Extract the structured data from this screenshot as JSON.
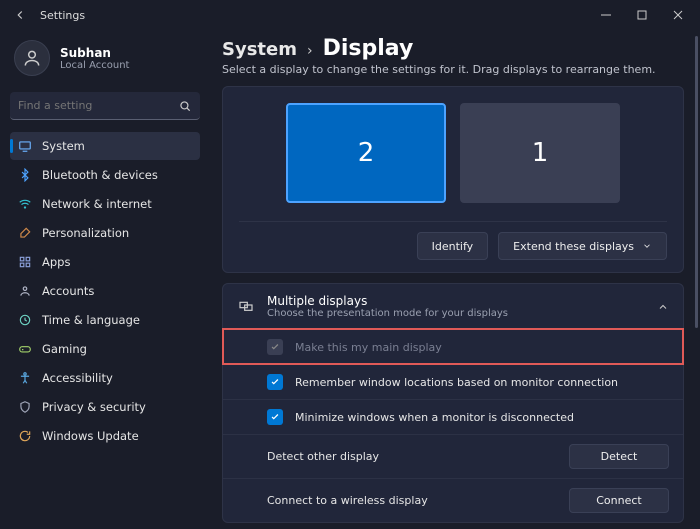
{
  "window": {
    "title": "Settings"
  },
  "profile": {
    "name": "Subhan",
    "sub": "Local Account"
  },
  "search": {
    "placeholder": "Find a setting"
  },
  "nav": [
    {
      "key": "system",
      "label": "System"
    },
    {
      "key": "bluetooth",
      "label": "Bluetooth & devices"
    },
    {
      "key": "network",
      "label": "Network & internet"
    },
    {
      "key": "personalization",
      "label": "Personalization"
    },
    {
      "key": "apps",
      "label": "Apps"
    },
    {
      "key": "accounts",
      "label": "Accounts"
    },
    {
      "key": "time",
      "label": "Time & language"
    },
    {
      "key": "gaming",
      "label": "Gaming"
    },
    {
      "key": "accessibility",
      "label": "Accessibility"
    },
    {
      "key": "privacy",
      "label": "Privacy & security"
    },
    {
      "key": "update",
      "label": "Windows Update"
    }
  ],
  "breadcrumb": {
    "parent": "System",
    "current": "Display"
  },
  "subtitle": "Select a display to change the settings for it. Drag displays to rearrange them.",
  "displays": {
    "primary": "2",
    "secondary": "1"
  },
  "display_actions": {
    "identify": "Identify",
    "extend": "Extend these displays"
  },
  "section": {
    "title": "Multiple displays",
    "sub": "Choose the presentation mode for your displays"
  },
  "options": {
    "main": "Make this my main display",
    "remember": "Remember window locations based on monitor connection",
    "minimize": "Minimize windows when a monitor is disconnected",
    "detect_label": "Detect other display",
    "detect_btn": "Detect",
    "connect_label": "Connect to a wireless display",
    "connect_btn": "Connect"
  },
  "colors": {
    "accent": "#0078d4"
  }
}
